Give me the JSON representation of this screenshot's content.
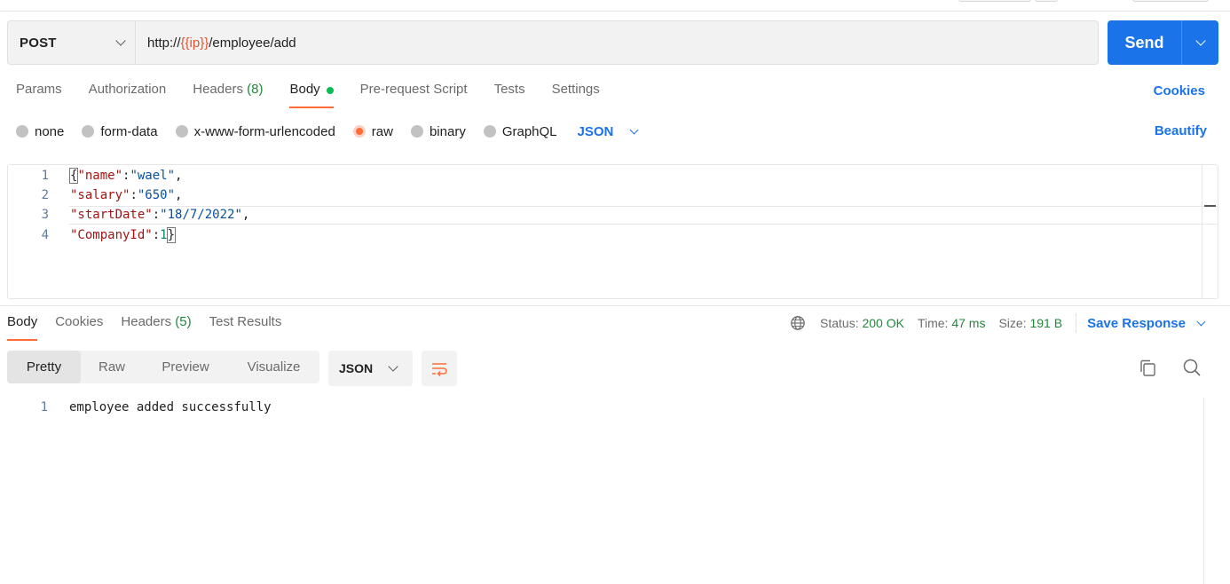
{
  "request": {
    "method": "POST",
    "url_prefix": "http://",
    "url_variable": "{{ip}}",
    "url_suffix": "/employee/add",
    "send_label": "Send"
  },
  "request_tabs": [
    {
      "label": "Params"
    },
    {
      "label": "Authorization"
    },
    {
      "label": "Headers",
      "count": "(8)"
    },
    {
      "label": "Body"
    },
    {
      "label": "Pre-request Script"
    },
    {
      "label": "Tests"
    },
    {
      "label": "Settings"
    }
  ],
  "cookies_label": "Cookies",
  "body_options": [
    {
      "label": "none"
    },
    {
      "label": "form-data"
    },
    {
      "label": "x-www-form-urlencoded"
    },
    {
      "label": "raw",
      "selected": true
    },
    {
      "label": "binary"
    },
    {
      "label": "GraphQL"
    }
  ],
  "body_format": "JSON",
  "beautify_label": "Beautify",
  "editor_lines": [
    {
      "num": "1",
      "open": "{",
      "key": "\"name\"",
      "colon": ":",
      "value": "\"wael\"",
      "tail": ","
    },
    {
      "num": "2",
      "key": "\"salary\"",
      "colon": ":",
      "value": "\"650\"",
      "tail": ","
    },
    {
      "num": "3",
      "key": "\"startDate\"",
      "colon": ":",
      "value": "\"18/7/2022\"",
      "tail": ","
    },
    {
      "num": "4",
      "key": "\"CompanyId\"",
      "colon": ":",
      "value": "1",
      "close": "}"
    }
  ],
  "response_tabs": [
    {
      "label": "Body"
    },
    {
      "label": "Cookies"
    },
    {
      "label": "Headers",
      "count": "(5)"
    },
    {
      "label": "Test Results"
    }
  ],
  "status": {
    "status_label": "Status:",
    "status_value": "200 OK",
    "time_label": "Time:",
    "time_value": "47 ms",
    "size_label": "Size:",
    "size_value": "191 B",
    "save_label": "Save Response"
  },
  "view_modes": [
    {
      "label": "Pretty"
    },
    {
      "label": "Raw"
    },
    {
      "label": "Preview"
    },
    {
      "label": "Visualize"
    }
  ],
  "response_format": "JSON",
  "response_lines": [
    {
      "num": "1",
      "text": "employee added successfully"
    }
  ],
  "colors": {
    "accent": "#1a73e8",
    "active_tab": "#ff6c37",
    "variable": "#e0532f",
    "success": "#20883b"
  }
}
